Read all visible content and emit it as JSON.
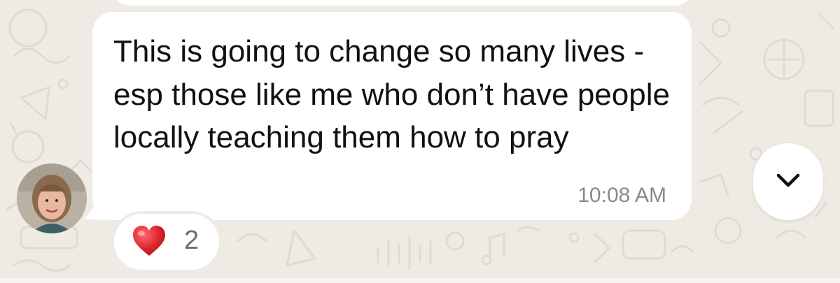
{
  "colors": {
    "wallpaper": "#efebe4",
    "bubble": "#ffffff",
    "text": "#111111",
    "timestamp": "#8a8a8a",
    "heart": "#e0262f"
  },
  "message": {
    "text": "This is going to change so many lives - esp those like me who don’t have people locally teaching them how to pray",
    "time": "10:08 AM"
  },
  "reaction": {
    "emoji": "heart-icon",
    "count": "2"
  },
  "controls": {
    "scroll_icon": "chevron-down-icon"
  }
}
